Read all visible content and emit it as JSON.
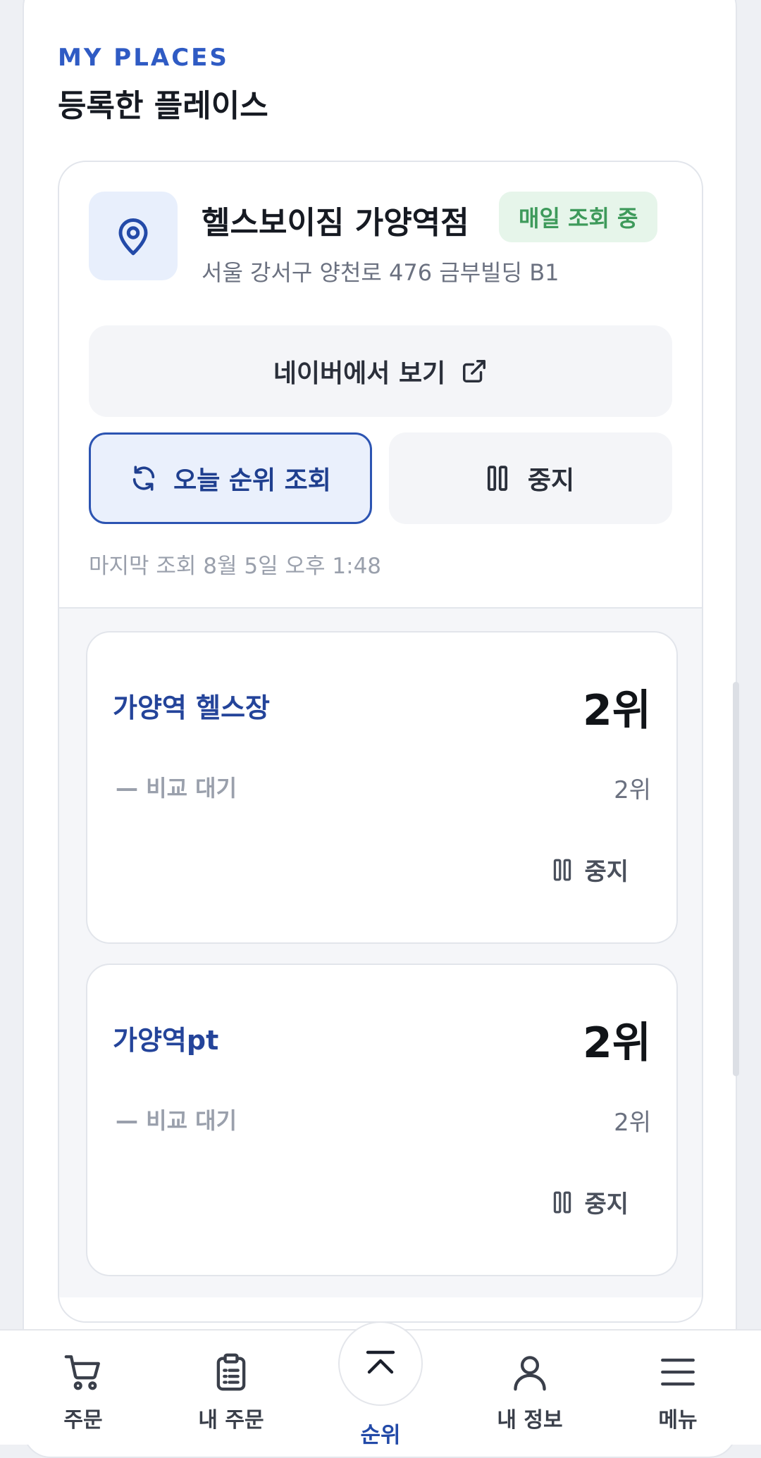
{
  "section": {
    "eyebrow": "MY PLACES",
    "title": "등록한 플레이스"
  },
  "place": {
    "name": "헬스보이짐 가양역점",
    "status_badge": "매일 조회 중",
    "address": "서울 강서구 양천로 476 금부빌딩 B1",
    "naver_button": "네이버에서 보기",
    "refresh_button": "오늘 순위 조회",
    "stop_button": "중지",
    "last_checked": "마지막 조회 8월 5일 오후 1:48"
  },
  "keywords": [
    {
      "name": "가양역 헬스장",
      "rank": "2위",
      "compare": "— 비교 대기",
      "previous_rank": "2위",
      "stop_label": "중지"
    },
    {
      "name": "가양역pt",
      "rank": "2위",
      "compare": "— 비교 대기",
      "previous_rank": "2위",
      "stop_label": "중지"
    }
  ],
  "tabbar": {
    "items": [
      {
        "label": "주문",
        "icon": "cart-icon"
      },
      {
        "label": "내 주문",
        "icon": "clipboard-icon"
      },
      {
        "label": "순위",
        "icon": "chevron-up-icon",
        "active": true
      },
      {
        "label": "내 정보",
        "icon": "user-icon"
      },
      {
        "label": "메뉴",
        "icon": "menu-icon"
      }
    ]
  },
  "colors": {
    "accent": "#2c54b2",
    "badge_bg": "#e6f5ea",
    "badge_text": "#3e9a5b"
  }
}
